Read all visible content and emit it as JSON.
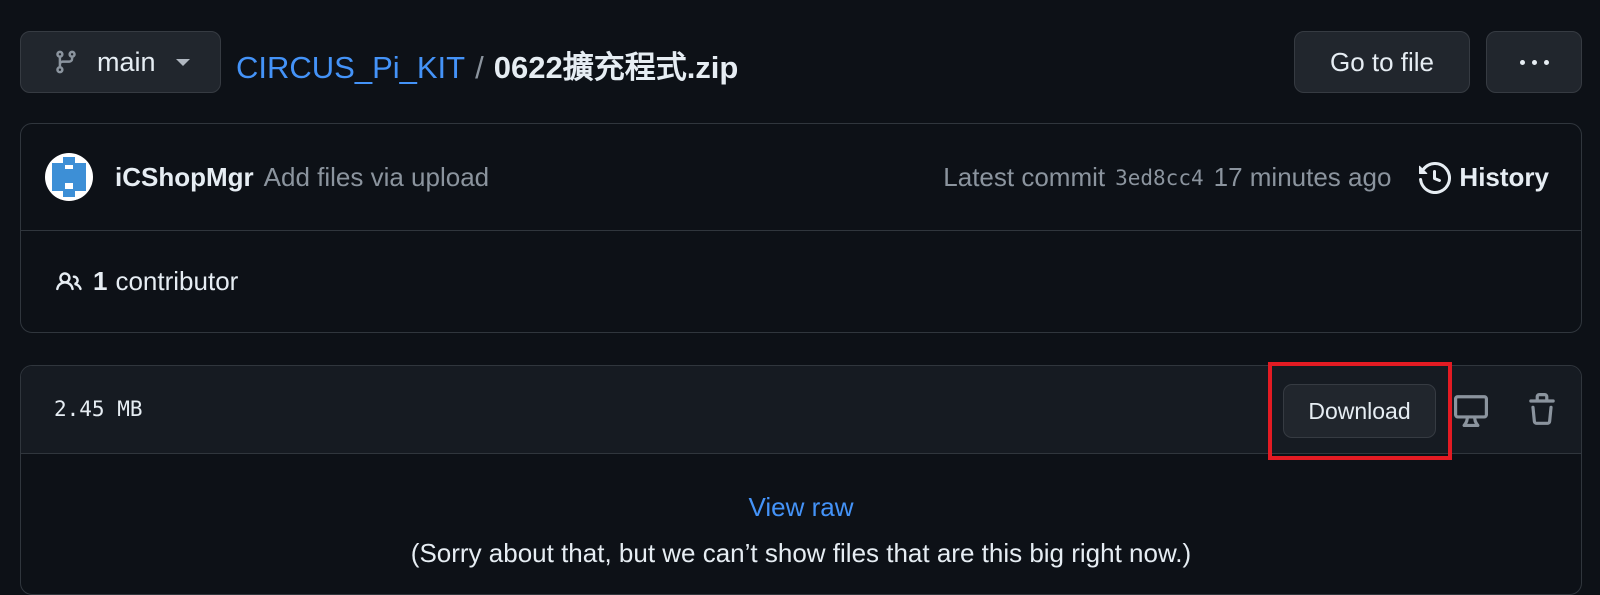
{
  "branch": {
    "name": "main"
  },
  "breadcrumb": {
    "repo": "CIRCUS_Pi_KIT",
    "separator": "/",
    "file": "0622擴充程式.zip"
  },
  "header_actions": {
    "go_to_file": "Go to file"
  },
  "commit": {
    "author": "iCShopMgr",
    "message": "Add files via upload",
    "latest_label": "Latest commit",
    "sha": "3ed8cc4",
    "time": "17 minutes ago",
    "history_label": "History"
  },
  "contributors": {
    "count": "1",
    "label": "contributor"
  },
  "file": {
    "size": "2.45 MB",
    "download_label": "Download",
    "view_raw": "View raw",
    "too_big_message": "(Sorry about that, but we can’t show files that are this big right now.)"
  },
  "colors": {
    "accent": "#4493f8",
    "highlight": "#e31b23",
    "background": "#0d1117"
  }
}
